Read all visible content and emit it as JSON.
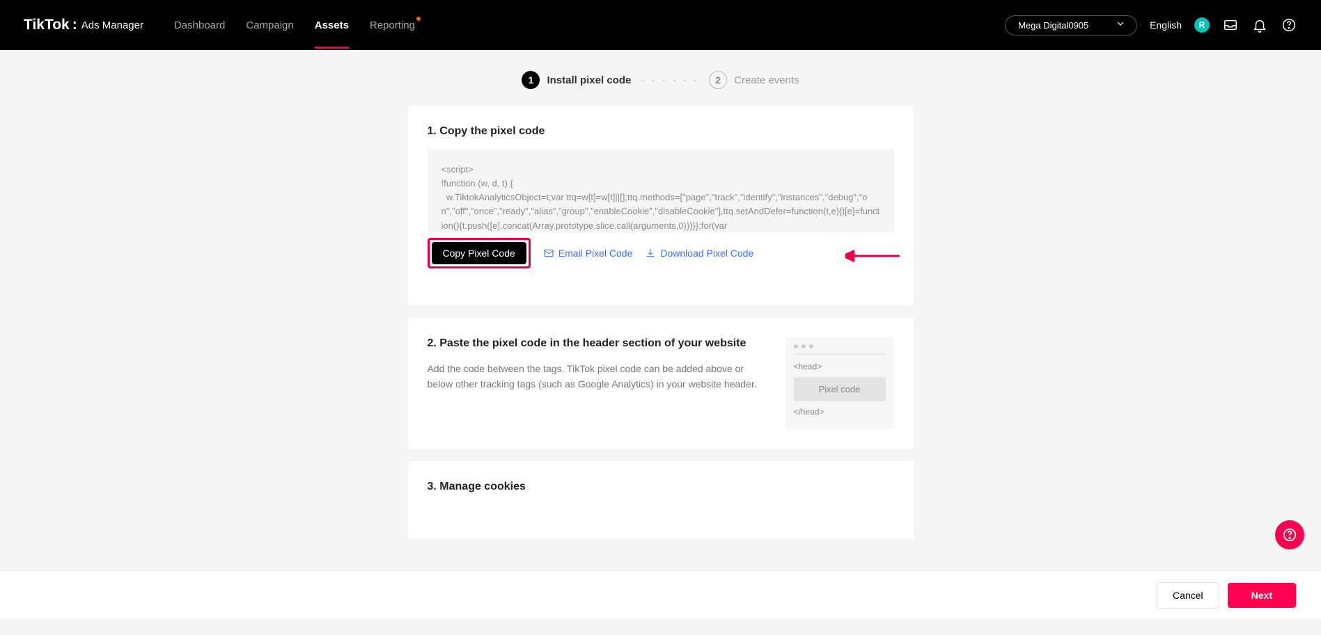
{
  "header": {
    "brand_main": "TikTok",
    "brand_sep": ":",
    "brand_sub": "Ads Manager",
    "nav": {
      "dashboard": "Dashboard",
      "campaign": "Campaign",
      "assets": "Assets",
      "reporting": "Reporting"
    },
    "account": "Mega Digital0905",
    "language": "English",
    "avatar_letter": "R"
  },
  "stepper": {
    "step1_num": "1",
    "step1_label": "Install pixel code",
    "step2_num": "2",
    "step2_label": "Create events"
  },
  "section1": {
    "title": "1. Copy the pixel code",
    "code": "<script>\n!function (w, d, t) {\n  w.TiktokAnalyticsObject=t;var ttq=w[t]=w[t]||[];ttq.methods=[\"page\",\"track\",\"identify\",\"instances\",\"debug\",\"on\",\"off\",\"once\",\"ready\",\"alias\",\"group\",\"enableCookie\",\"disableCookie\"],ttq.setAndDefer=function(t,e){t[e]=function(){t.push([e].concat(Array.prototype.slice.call(arguments,0)))}};for(var",
    "copy_btn": "Copy Pixel Code",
    "email_link": "Email Pixel Code",
    "download_link": "Download Pixel Code"
  },
  "section2": {
    "title": "2. Paste the pixel code in the header section of your website",
    "desc": "Add the code between the tags. TikTok pixel code can be added above or below other tracking tags (such as Google Analytics) in your website header.",
    "mock_head_open": "<head>",
    "mock_pixel": "Pixel code",
    "mock_head_close": "</head>"
  },
  "section3": {
    "title": "3. Manage cookies"
  },
  "footer": {
    "cancel": "Cancel",
    "next": "Next"
  }
}
